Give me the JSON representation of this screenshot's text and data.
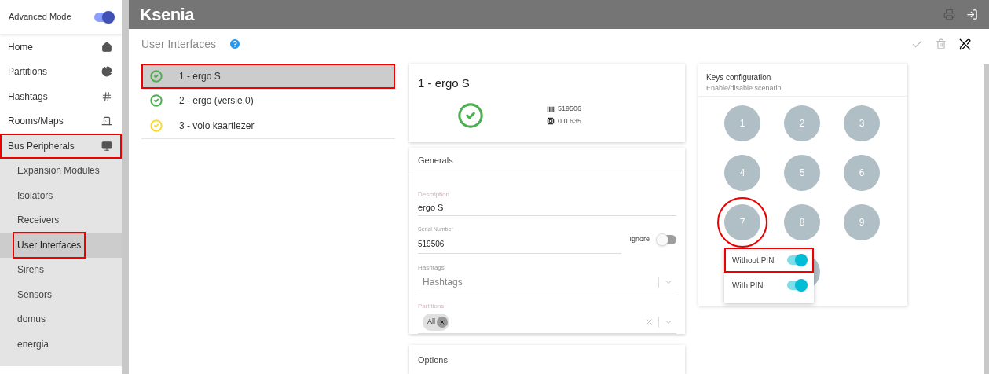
{
  "sidebar": {
    "advanced_mode": {
      "label": "Advanced Mode",
      "on": true
    },
    "items": [
      {
        "label": "Home",
        "selected": false,
        "annotated": false,
        "expanded": false
      },
      {
        "label": "Partitions",
        "selected": false,
        "annotated": false,
        "expanded": false
      },
      {
        "label": "Hashtags",
        "selected": false,
        "annotated": false,
        "expanded": false
      },
      {
        "label": "Rooms/Maps",
        "selected": false,
        "annotated": false,
        "expanded": false
      },
      {
        "label": "Bus Peripherals",
        "selected": false,
        "annotated": true,
        "expanded": true,
        "children": [
          {
            "label": "Expansion Modules",
            "selected": false,
            "annotated": false
          },
          {
            "label": "Isolators",
            "selected": false,
            "annotated": false
          },
          {
            "label": "Receivers",
            "selected": false,
            "annotated": false
          },
          {
            "label": "User Interfaces",
            "selected": true,
            "annotated": true
          },
          {
            "label": "Sirens",
            "selected": false,
            "annotated": false
          },
          {
            "label": "Sensors",
            "selected": false,
            "annotated": false
          },
          {
            "label": "domus",
            "selected": false,
            "annotated": false
          },
          {
            "label": "energia",
            "selected": false,
            "annotated": false
          }
        ]
      }
    ]
  },
  "topbar": {
    "logo": "Ksenia"
  },
  "page_title": "User Interfaces",
  "toolbar": {
    "save_disabled": true,
    "delete_disabled": true
  },
  "devices": [
    {
      "label": "1 - ergo S",
      "color": "#4caf50",
      "selected": true,
      "annotated": true
    },
    {
      "label": "2 - ergo (versie.0)",
      "color": "#4caf50",
      "selected": false,
      "annotated": false
    },
    {
      "label": "3 - volo kaartlezer",
      "color": "#fdd835",
      "selected": false,
      "annotated": false
    }
  ],
  "detail": {
    "title": "1 - ergo S",
    "color": "#4caf50",
    "serial": "519506",
    "firmware": "0.0.635"
  },
  "generals": {
    "title": "Generals",
    "description": {
      "label": "Description",
      "value": "ergo S"
    },
    "serial_number": {
      "label": "Serial Number",
      "value": "519506"
    },
    "ignore": {
      "label": "Ignore",
      "on": false
    },
    "hashtags": {
      "label": "Hashtags",
      "placeholder": "Hashtags"
    },
    "partitions": {
      "label": "Partitions",
      "chips": [
        "All"
      ]
    }
  },
  "options": {
    "title": "Options"
  },
  "keys": {
    "title": "Keys configuration",
    "subtitle": "Enable/disable scenario",
    "items": [
      {
        "label": "1",
        "annotated": false
      },
      {
        "label": "2",
        "annotated": false
      },
      {
        "label": "3",
        "annotated": false
      },
      {
        "label": "4",
        "annotated": false
      },
      {
        "label": "5",
        "annotated": false
      },
      {
        "label": "6",
        "annotated": false
      },
      {
        "label": "7",
        "annotated": true
      },
      {
        "label": "8",
        "annotated": false
      },
      {
        "label": "9",
        "annotated": false
      }
    ],
    "popup": [
      {
        "label": "Without PIN",
        "on": true,
        "annotated": true
      },
      {
        "label": "With PIN",
        "on": true,
        "annotated": false
      }
    ]
  }
}
